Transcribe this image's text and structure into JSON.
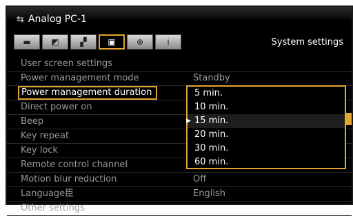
{
  "header": {
    "source_icon": "input-source-icon",
    "source_label": "Analog PC-1",
    "section_title": "System settings",
    "tabs": [
      {
        "icon": "image-mode-icon",
        "glyph": "▬"
      },
      {
        "icon": "image-adjust-icon",
        "glyph": "◩"
      },
      {
        "icon": "setup-icon",
        "glyph": "▞"
      },
      {
        "icon": "system-icon",
        "glyph": "▣"
      },
      {
        "icon": "network-icon",
        "glyph": "⊕"
      },
      {
        "icon": "info-icon",
        "glyph": "i"
      }
    ],
    "active_tab": 3
  },
  "menu": {
    "items": [
      {
        "label": "User screen settings",
        "value": ""
      },
      {
        "label": "Power management mode",
        "value": "Standby"
      },
      {
        "label": "Power management duration",
        "value": "5 min."
      },
      {
        "label": "Direct power on",
        "value": ""
      },
      {
        "label": "Beep",
        "value": ""
      },
      {
        "label": "Key repeat",
        "value": ""
      },
      {
        "label": "Key lock",
        "value": ""
      },
      {
        "label": "Remote control channel",
        "value": ""
      },
      {
        "label": "Motion blur reduction",
        "value": "Off"
      },
      {
        "label": "Language⾂",
        "value": "English"
      },
      {
        "label": "Other settings",
        "value": ""
      }
    ],
    "selected_index": 2
  },
  "dropdown": {
    "options": [
      "5 min.",
      "10 min.",
      "15 min.",
      "20 min.",
      "30 min.",
      "60 min."
    ],
    "current_index": 2,
    "current_marker": "▶"
  },
  "colors": {
    "accent": "#e2a531",
    "text": "#ffffff",
    "dim_text": "#9a9a9a",
    "background": "#000000"
  }
}
